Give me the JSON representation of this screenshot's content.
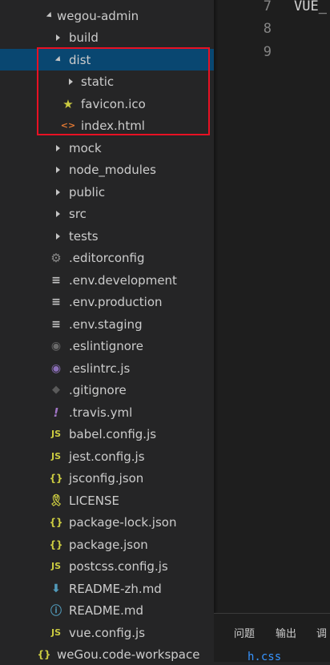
{
  "explorer": {
    "root": {
      "label": "wegou-admin"
    },
    "items": [
      {
        "label": "build"
      },
      {
        "label": "dist"
      },
      {
        "label": "static"
      },
      {
        "label": "favicon.ico"
      },
      {
        "label": "index.html"
      },
      {
        "label": "mock"
      },
      {
        "label": "node_modules"
      },
      {
        "label": "public"
      },
      {
        "label": "src"
      },
      {
        "label": "tests"
      },
      {
        "label": ".editorconfig"
      },
      {
        "label": ".env.development"
      },
      {
        "label": ".env.production"
      },
      {
        "label": ".env.staging"
      },
      {
        "label": ".eslintignore"
      },
      {
        "label": ".eslintrc.js"
      },
      {
        "label": ".gitignore"
      },
      {
        "label": ".travis.yml"
      },
      {
        "label": "babel.config.js"
      },
      {
        "label": "jest.config.js"
      },
      {
        "label": "jsconfig.json"
      },
      {
        "label": "LICENSE"
      },
      {
        "label": "package-lock.json"
      },
      {
        "label": "package.json"
      },
      {
        "label": "postcss.config.js"
      },
      {
        "label": "README-zh.md"
      },
      {
        "label": "README.md"
      },
      {
        "label": "vue.config.js"
      }
    ],
    "workspace": {
      "label": "weGou.code-workspace"
    },
    "icon_text": {
      "js": "JS",
      "json": "{}",
      "yml": "!",
      "html": "<>"
    }
  },
  "editor": {
    "lines": [
      {
        "num": "7",
        "text": "VUE_"
      },
      {
        "num": "8",
        "text": ""
      },
      {
        "num": "9",
        "text": ""
      }
    ]
  },
  "panel": {
    "tabs": [
      "问题",
      "输出",
      "调"
    ],
    "content": "h.css"
  },
  "colors": {
    "selection": "#094771",
    "highlight_border": "#e81123",
    "js_icon": "#cbcb41",
    "json_icon": "#cbcb41",
    "html_icon": "#e37933",
    "star_icon": "#cbcb41",
    "eslint_icon": "#8b6fb8"
  }
}
